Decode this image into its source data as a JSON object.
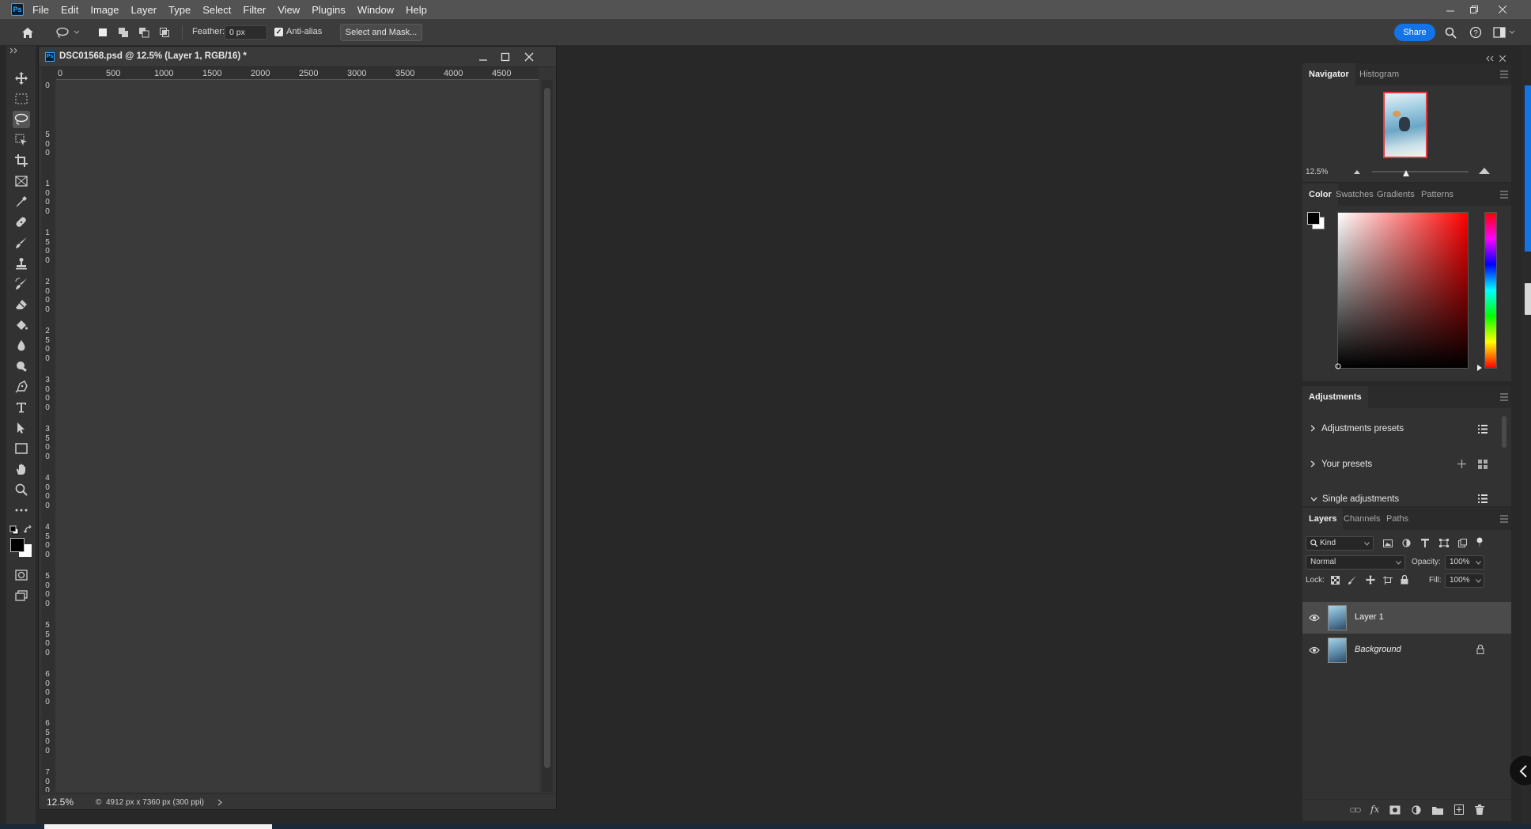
{
  "menubar": {
    "logo": "Ps",
    "items": [
      "File",
      "Edit",
      "Image",
      "Layer",
      "Type",
      "Select",
      "Filter",
      "View",
      "Plugins",
      "Window",
      "Help"
    ]
  },
  "optionsbar": {
    "feather_label": "Feather:",
    "feather_value": "0 px",
    "antialias_label": "Anti-alias",
    "select_mask_label": "Select and Mask...",
    "share_label": "Share"
  },
  "document": {
    "title": "DSC01568.psd @ 12.5% (Layer 1, RGB/16) *",
    "ruler_h": [
      "0",
      "500",
      "1000",
      "1500",
      "2000",
      "2500",
      "3000",
      "3500",
      "4000",
      "4500"
    ],
    "ruler_v": [
      "0",
      "500",
      "1000",
      "1500",
      "2000",
      "2500",
      "3000",
      "3500",
      "4000",
      "4500",
      "5000",
      "5500",
      "6000",
      "6500",
      "7000"
    ],
    "zoom": "12.5%",
    "info": "4912 px x 7360 px (300 ppi)"
  },
  "navigator": {
    "tabs": [
      "Navigator",
      "Histogram"
    ],
    "zoom": "12.5%"
  },
  "color": {
    "tabs": [
      "Color",
      "Swatches",
      "Gradients",
      "Patterns"
    ],
    "foreground": "#000000",
    "background": "#ffffff",
    "hue_color": "#ff0000"
  },
  "adjustments": {
    "tab": "Adjustments",
    "rows": [
      "Adjustments presets",
      "Your presets",
      "Single adjustments"
    ]
  },
  "layers": {
    "tabs": [
      "Layers",
      "Channels",
      "Paths"
    ],
    "filter": "Kind",
    "blend_mode": "Normal",
    "opacity_label": "Opacity:",
    "opacity": "100%",
    "lock_label": "Lock:",
    "fill_label": "Fill:",
    "fill": "100%",
    "items": [
      {
        "name": "Layer 1",
        "selected": true
      },
      {
        "name": "Background",
        "selected": false
      }
    ]
  }
}
